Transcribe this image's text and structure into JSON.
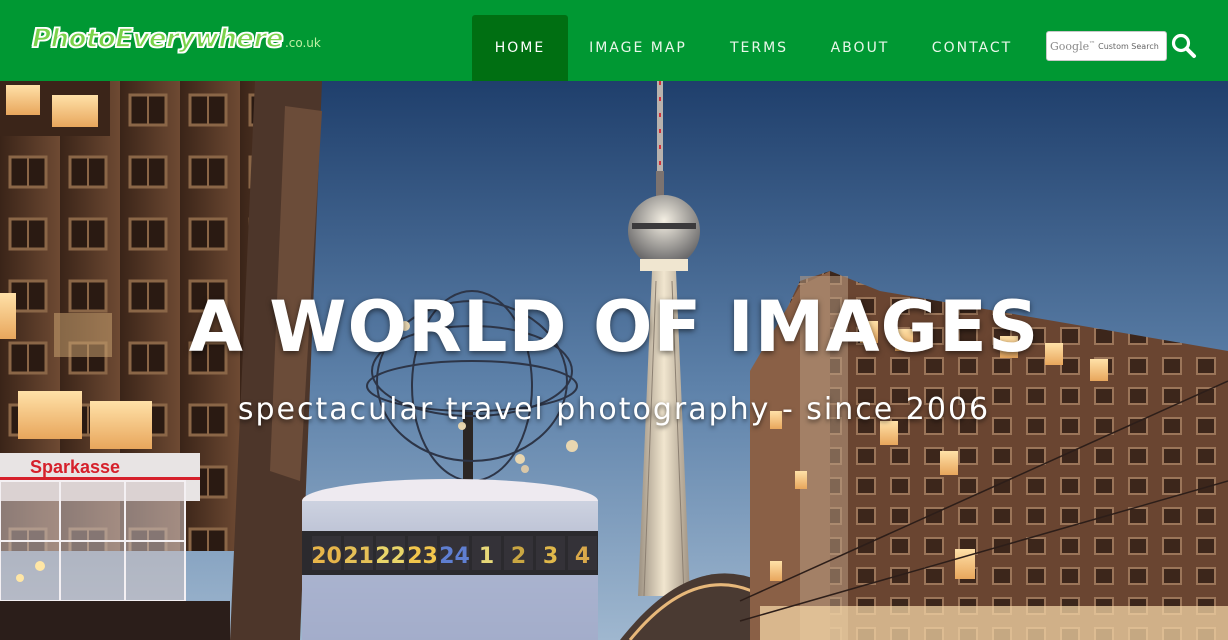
{
  "logo": {
    "name": "PhotoEverywhere",
    "tld": ".co.uk"
  },
  "nav": {
    "items": [
      {
        "label": "HOME",
        "active": true
      },
      {
        "label": "IMAGE MAP",
        "active": false
      },
      {
        "label": "TERMS",
        "active": false
      },
      {
        "label": "ABOUT",
        "active": false
      },
      {
        "label": "CONTACT",
        "active": false
      }
    ]
  },
  "search": {
    "brand": "Google",
    "trademark": "™",
    "placeholder": "Custom Search",
    "button_icon": "search-icon"
  },
  "hero": {
    "title": "A WORLD OF IMAGES",
    "subtitle": "spectacular travel photography - since 2006",
    "sign_text": "Sparkasse",
    "clock_numbers": [
      "20",
      "21",
      "22",
      "23",
      "24",
      "1",
      "2",
      "3",
      "4"
    ]
  },
  "colors": {
    "nav_bg": "#009833",
    "nav_active": "#006f12",
    "sky_top": "#1f3f6c",
    "sky_bottom": "#8aa9c8"
  }
}
